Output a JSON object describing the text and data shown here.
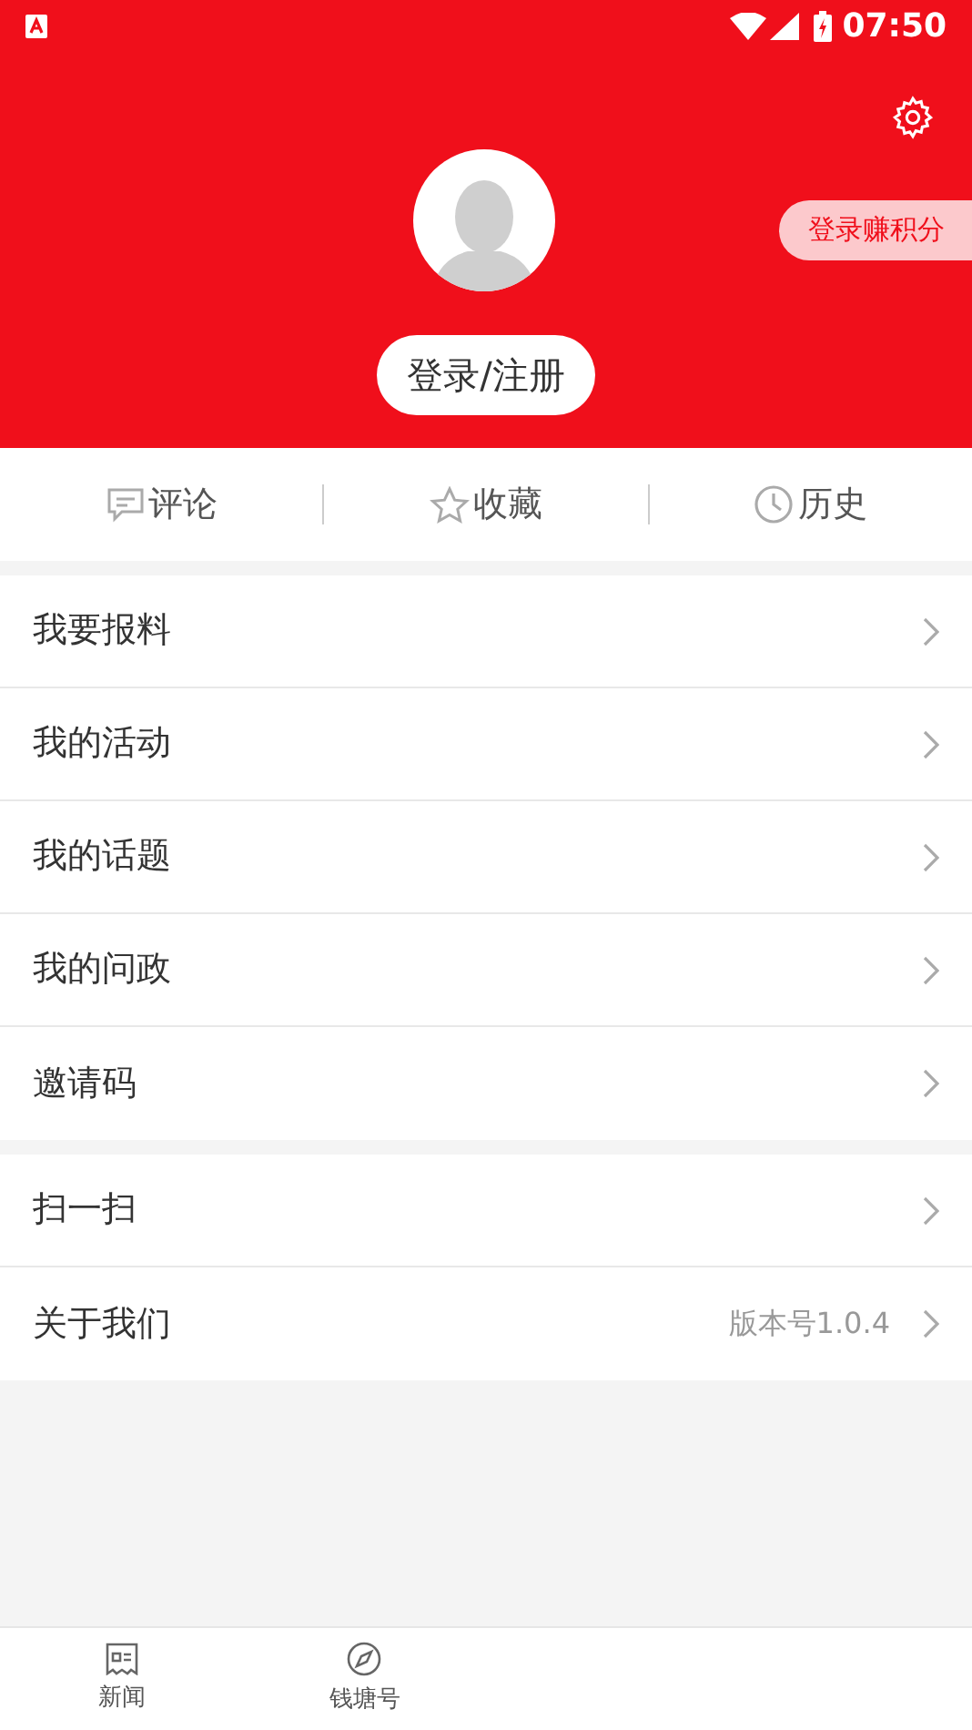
{
  "status_bar": {
    "time": "07:50"
  },
  "header": {
    "login_button": "登录/注册",
    "points_badge": "登录赚积分"
  },
  "shortcuts": [
    {
      "kind": "comment",
      "label": "评论"
    },
    {
      "kind": "star",
      "label": "收藏"
    },
    {
      "kind": "clock",
      "label": "历史"
    }
  ],
  "menu_groups": [
    [
      {
        "label": "我要报料"
      },
      {
        "label": "我的活动"
      },
      {
        "label": "我的话题"
      },
      {
        "label": "我的问政"
      },
      {
        "label": "邀请码"
      }
    ],
    [
      {
        "label": "扫一扫"
      },
      {
        "label": "关于我们",
        "value": "版本号1.0.4"
      }
    ]
  ],
  "bottom_nav": [
    {
      "kind": "news",
      "label": "新闻",
      "selected": false
    },
    {
      "kind": "compass",
      "label": "钱塘号",
      "selected": false
    }
  ]
}
